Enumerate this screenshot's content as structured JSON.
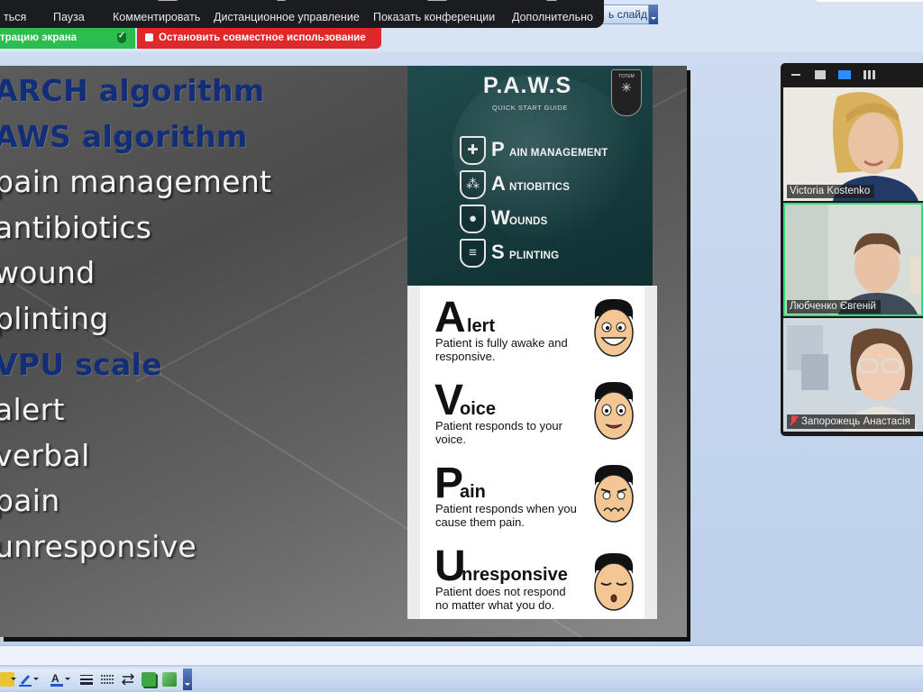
{
  "zoom_toolbar": {
    "items": [
      "ться",
      "Пауза",
      "Комментировать",
      "Дистанционное управление",
      "Показать конференции",
      "Дополнительно"
    ],
    "share_status": "трацию экрана",
    "stop_share": "Остановить совместное использование"
  },
  "powerpoint": {
    "next_slide_label": "ь слайд"
  },
  "slide": {
    "bullets": [
      {
        "text": "ARCH algorithm",
        "style": "head"
      },
      {
        "text": "AWS algorithm",
        "style": "head"
      },
      {
        "text": "pain management",
        "style": "item"
      },
      {
        "text": "antibiotics",
        "style": "item"
      },
      {
        "text": "wound",
        "style": "item"
      },
      {
        "text": "plinting",
        "style": "item"
      },
      {
        "text": "VPU scale",
        "style": "head"
      },
      {
        "text": "alert",
        "style": "item"
      },
      {
        "text": "verbal",
        "style": "item"
      },
      {
        "text": "pain",
        "style": "item"
      },
      {
        "text": "unresponsive",
        "style": "item"
      }
    ],
    "paws": {
      "title": "P.A.W.S",
      "subtitle": "QUICK START GUIDE",
      "badge": "TOTEM",
      "rows": [
        {
          "letter": "P",
          "word": "AIN MANAGEMENT",
          "icon": "injection-icon"
        },
        {
          "letter": "A",
          "word": "NTIOBITICS",
          "icon": "pills-icon"
        },
        {
          "letter": "W",
          "word": "OUNDS",
          "icon": "drop-icon"
        },
        {
          "letter": "S",
          "word": "PLINTING",
          "icon": "splint-icon"
        }
      ]
    },
    "avpu": [
      {
        "letter": "A",
        "rest": "lert",
        "desc": "Patient is fully awake and responsive.",
        "face": "smiling-face"
      },
      {
        "letter": "V",
        "rest": "oice",
        "desc": "Patient responds to your voice.",
        "face": "surprised-face"
      },
      {
        "letter": "P",
        "rest": "ain",
        "desc": "Patient responds when you cause them pain.",
        "face": "pained-face"
      },
      {
        "letter": "U",
        "rest": "nresponsive",
        "desc": "Patient does not respond no matter what you do.",
        "face": "sleepy-face"
      }
    ]
  },
  "participants": [
    {
      "name": "Victoria Kostenko",
      "muted": false,
      "active": false
    },
    {
      "name": "Любченко Євгеній",
      "muted": false,
      "active": true
    },
    {
      "name": "Запорожець Анастасія",
      "muted": true,
      "active": false
    }
  ],
  "colors": {
    "share_green": "#2dbd4f",
    "stop_red": "#e02828",
    "active_speaker": "#2ee07a",
    "heading_blue": "#122e78"
  }
}
